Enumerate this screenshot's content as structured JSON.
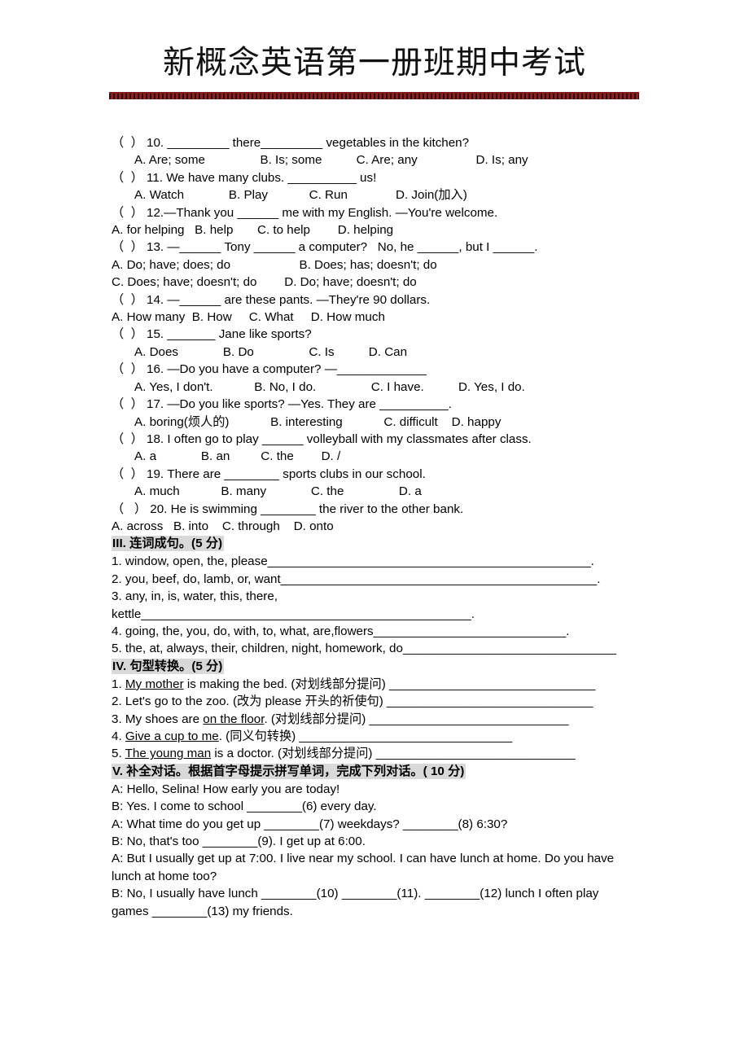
{
  "document": {
    "title": "新概念英语第一册班期中考试",
    "accent_color": "#7d1b1b",
    "highlight_color": "#d9d9d9"
  },
  "multiple_choice": {
    "questions": [
      {
        "stem": "（  ） 10. _________ there_________ vegetables in the kitchen?",
        "options": "A. Are; some                B. Is; some          C. Are; any                 D. Is; any",
        "options_indented": true
      },
      {
        "stem": "（  ） 11. We have many clubs. __________ us!",
        "options": "A. Watch             B. Play            C. Run              D. Join(加入)",
        "options_indented": true
      },
      {
        "stem": "（  ） 12.—Thank you ______ me with my English. —You're welcome.",
        "options": "A. for helping   B. help       C. to help        D. helping",
        "options_indented": false
      },
      {
        "stem": "（  ） 13. —______ Tony ______ a computer?   No, he ______, but I ______.",
        "options": "A. Do; have; does; do                    B. Does; has; doesn't; do",
        "options2": "C. Does; have; doesn't; do        D. Do; have; doesn't; do",
        "options_indented": false
      },
      {
        "stem": "（  ） 14. —______ are these pants. —They're 90 dollars.",
        "options": "A. How many  B. How     C. What     D. How much",
        "options_indented": false
      },
      {
        "stem": "（  ） 15. _______ Jane like sports?",
        "options": "A. Does             B. Do                C. Is          D. Can",
        "options_indented": true
      },
      {
        "stem": "（  ） 16. —Do you have a computer? —_____________",
        "options": "A. Yes, I don't.            B. No, I do.                C. I have.          D. Yes, I do.",
        "options_indented": true
      },
      {
        "stem": "（  ） 17. —Do you like sports? —Yes. They are __________.",
        "options": "A. boring(烦人的)            B. interesting            C. difficult    D. happy",
        "options_indented": true
      },
      {
        "stem": "（  ） 18. I often go to play ______ volleyball with my classmates after class.",
        "options": "A. a             B. an         C. the        D. /",
        "options_indented": true
      },
      {
        "stem": "（  ） 19. There are ________ sports clubs in our school.",
        "options": "A. much            B. many             C. the                D. a",
        "options_indented": true
      },
      {
        "stem": "（   ） 20. He is swimming ________ the river to the other bank.",
        "options": "A. across   B. into    C. through    D. onto",
        "options_indented": false
      }
    ]
  },
  "section_iii": {
    "heading": "III.  连词成句。(5 分)",
    "items": [
      "1. window, open, the, please_______________________________________________.",
      "2. you, beef, do, lamb, or, want______________________________________________.",
      "3. any, in, is, water, this, there, kettle________________________________________________.",
      "4. going, the, you, do, with, to, what, are,flowers____________________________.",
      "5. the, at, always, their, children, night, homework, do_______________________________"
    ]
  },
  "section_iv": {
    "heading": "IV.  句型转换。(5 分)",
    "items": [
      {
        "prefix": "1. ",
        "underlined": "My mother",
        "rest": " is making the bed. (对划线部分提问) ______________________________"
      },
      {
        "prefix": "2. ",
        "underlined": "",
        "rest": "Let's go to the zoo. (改为 please 开头的祈使句) ______________________________"
      },
      {
        "prefix": "3. My shoes are ",
        "underlined": "on the floor",
        "rest": ". (对划线部分提问) _____________________________"
      },
      {
        "prefix": "4. ",
        "underlined": "Give a cup to me",
        "rest": ". (同义句转换) _______________________________"
      },
      {
        "prefix": "5. ",
        "underlined": "The young man",
        "rest": " is a doctor. (对划线部分提问) _____________________________"
      }
    ]
  },
  "section_v": {
    "heading": "V. 补全对话。根据首字母提示拼写单词，完成下列对话。( 10 分)",
    "dialogue": [
      "A: Hello, Selina! How early you are today!",
      "B: Yes. I come to school ________(6) every day.",
      "A: What time do you get up ________(7) weekdays? ________(8) 6:30?",
      "B: No, that's too ________(9). I get up at 6:00.",
      "A: But I usually get up at 7:00. I live near my school. I can have lunch at home. Do you have lunch at home too?",
      "B: No, I usually have lunch ________(10) ________(11). ________(12) lunch I often play games ________(13) my friends."
    ]
  }
}
